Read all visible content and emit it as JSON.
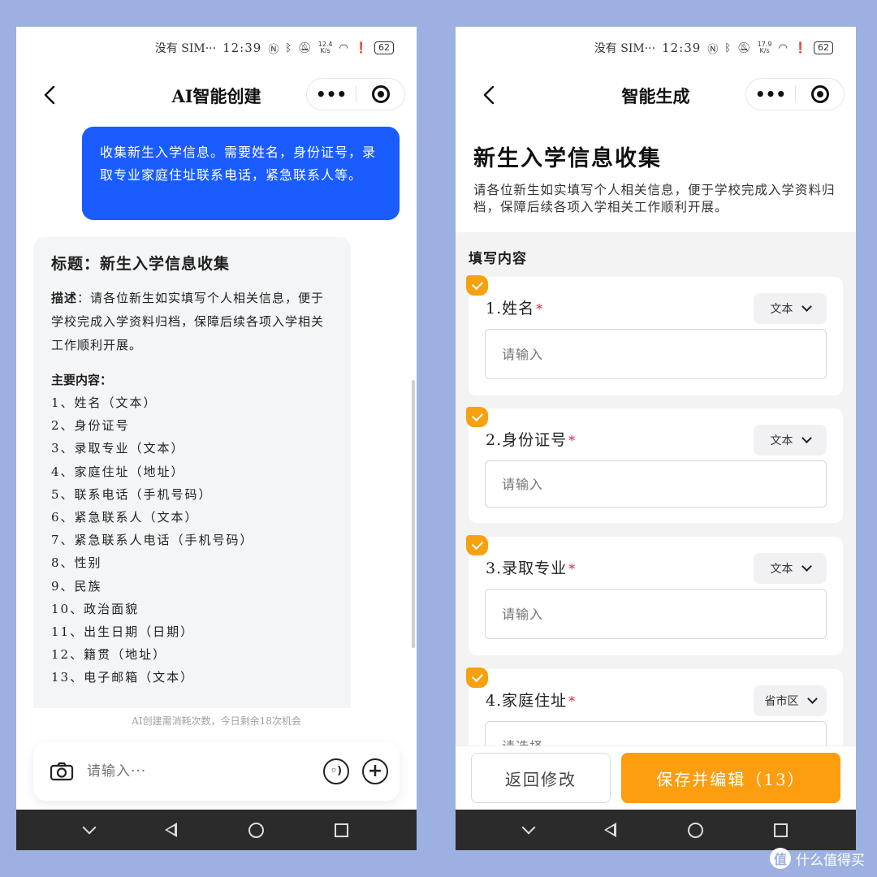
{
  "status_bar": {
    "carrier": "没有 SIM···",
    "time": "12:39",
    "left_speed_value": "12.4",
    "right_speed_value": "17.9",
    "speed_unit": "K/s",
    "battery": "62"
  },
  "left_screen": {
    "title": "AI智能创建",
    "user_message": "收集新生入学信息。需要姓名，身份证号，录取专业家庭住址联系电话，紧急联系人等。",
    "ai_card": {
      "title": "标题：新生入学信息收集",
      "desc_label": "描述",
      "desc_text": "：请各位新生如实填写个人相关信息，便于学校完成入学资料归档，保障后续各项入学相关工作顺利开展。",
      "content_label": "主要内容：",
      "items": [
        "1、姓名（文本）",
        "2、身份证号",
        "3、录取专业（文本）",
        "4、家庭住址（地址）",
        "5、联系电话（手机号码）",
        "6、紧急联系人（文本）",
        "7、紧急联系人电话（手机号码）",
        "8、性别",
        "9、民族",
        "10、政治面貌",
        "11、出生日期（日期）",
        "12、籍贯（地址）",
        "13、电子邮箱（文本）"
      ]
    },
    "quota_note": "AI创建需消耗次数，今日剩余18次机会",
    "input_placeholder": "请输入···"
  },
  "right_screen": {
    "title": "智能生成",
    "form_title": "新生入学信息收集",
    "form_desc": "请各位新生如实填写个人相关信息，便于学校完成入学资料归档，保障后续各项入学相关工作顺利开展。",
    "section_label": "填写内容",
    "fields": [
      {
        "label": "1.姓名",
        "required_mark": "*",
        "type": "文本",
        "placeholder": "请输入"
      },
      {
        "label": "2.身份证号",
        "required_mark": "*",
        "type": "文本",
        "placeholder": "请输入"
      },
      {
        "label": "3.录取专业",
        "required_mark": "*",
        "type": "文本",
        "placeholder": "请输入"
      },
      {
        "label": "4.家庭住址",
        "required_mark": "*",
        "type": "省市区",
        "placeholder": "请选择"
      }
    ],
    "back_button": "返回修改",
    "save_button": "保存并编辑（13）"
  },
  "watermark": {
    "text": "什么值得买",
    "logo": "值"
  },
  "colors": {
    "background": "#9cb0e2",
    "user_bubble": "#1a5cff",
    "accent_orange": "#fd9d10",
    "required_red": "#e0243b"
  }
}
